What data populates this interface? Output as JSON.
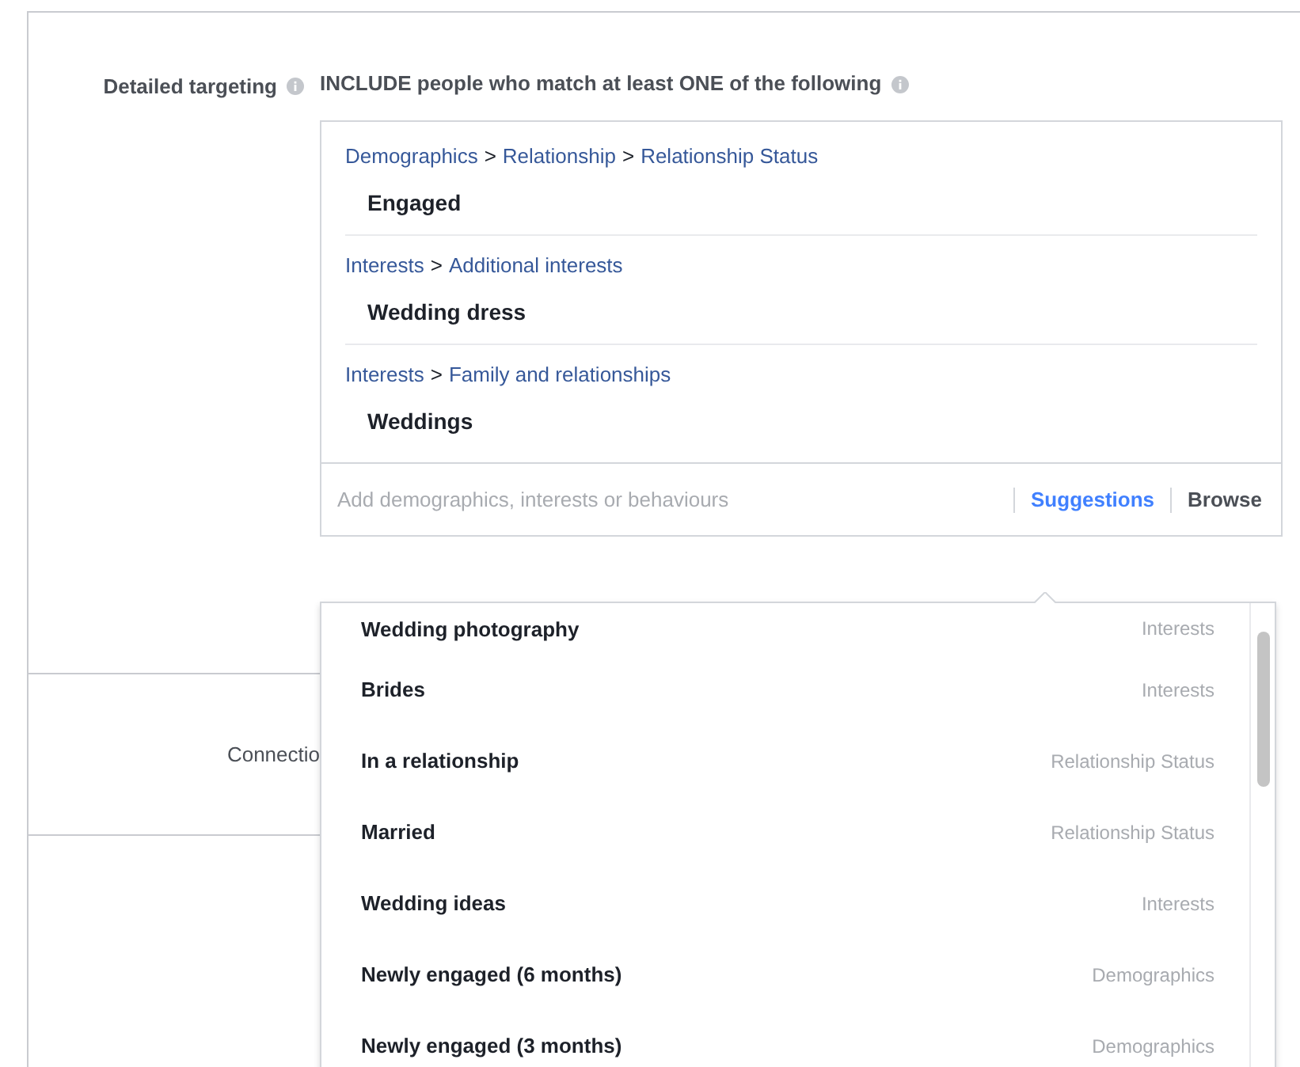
{
  "detailed_targeting": {
    "label": "Detailed targeting",
    "heading": "INCLUDE people who match at least ONE of the following"
  },
  "groups": [
    {
      "path": [
        "Demographics",
        "Relationship",
        "Relationship Status"
      ],
      "item": "Engaged"
    },
    {
      "path": [
        "Interests",
        "Additional interests"
      ],
      "item": "Wedding dress"
    },
    {
      "path": [
        "Interests",
        "Family and relationships"
      ],
      "item": "Weddings"
    }
  ],
  "path_separator": ">",
  "search": {
    "placeholder": "Add demographics, interests or behaviours"
  },
  "tabs": [
    {
      "label": "Suggestions",
      "selected": true
    },
    {
      "label": "Browse",
      "selected": false
    }
  ],
  "connections_label": "Connectio",
  "suggestions": [
    {
      "name": "Wedding photography",
      "category": "Interests"
    },
    {
      "name": "Brides",
      "category": "Interests"
    },
    {
      "name": "In a relationship",
      "category": "Relationship Status"
    },
    {
      "name": "Married",
      "category": "Relationship Status"
    },
    {
      "name": "Wedding ideas",
      "category": "Interests"
    },
    {
      "name": "Newly engaged (6 months)",
      "category": "Demographics"
    },
    {
      "name": "Newly engaged (3 months)",
      "category": "Demographics"
    }
  ]
}
